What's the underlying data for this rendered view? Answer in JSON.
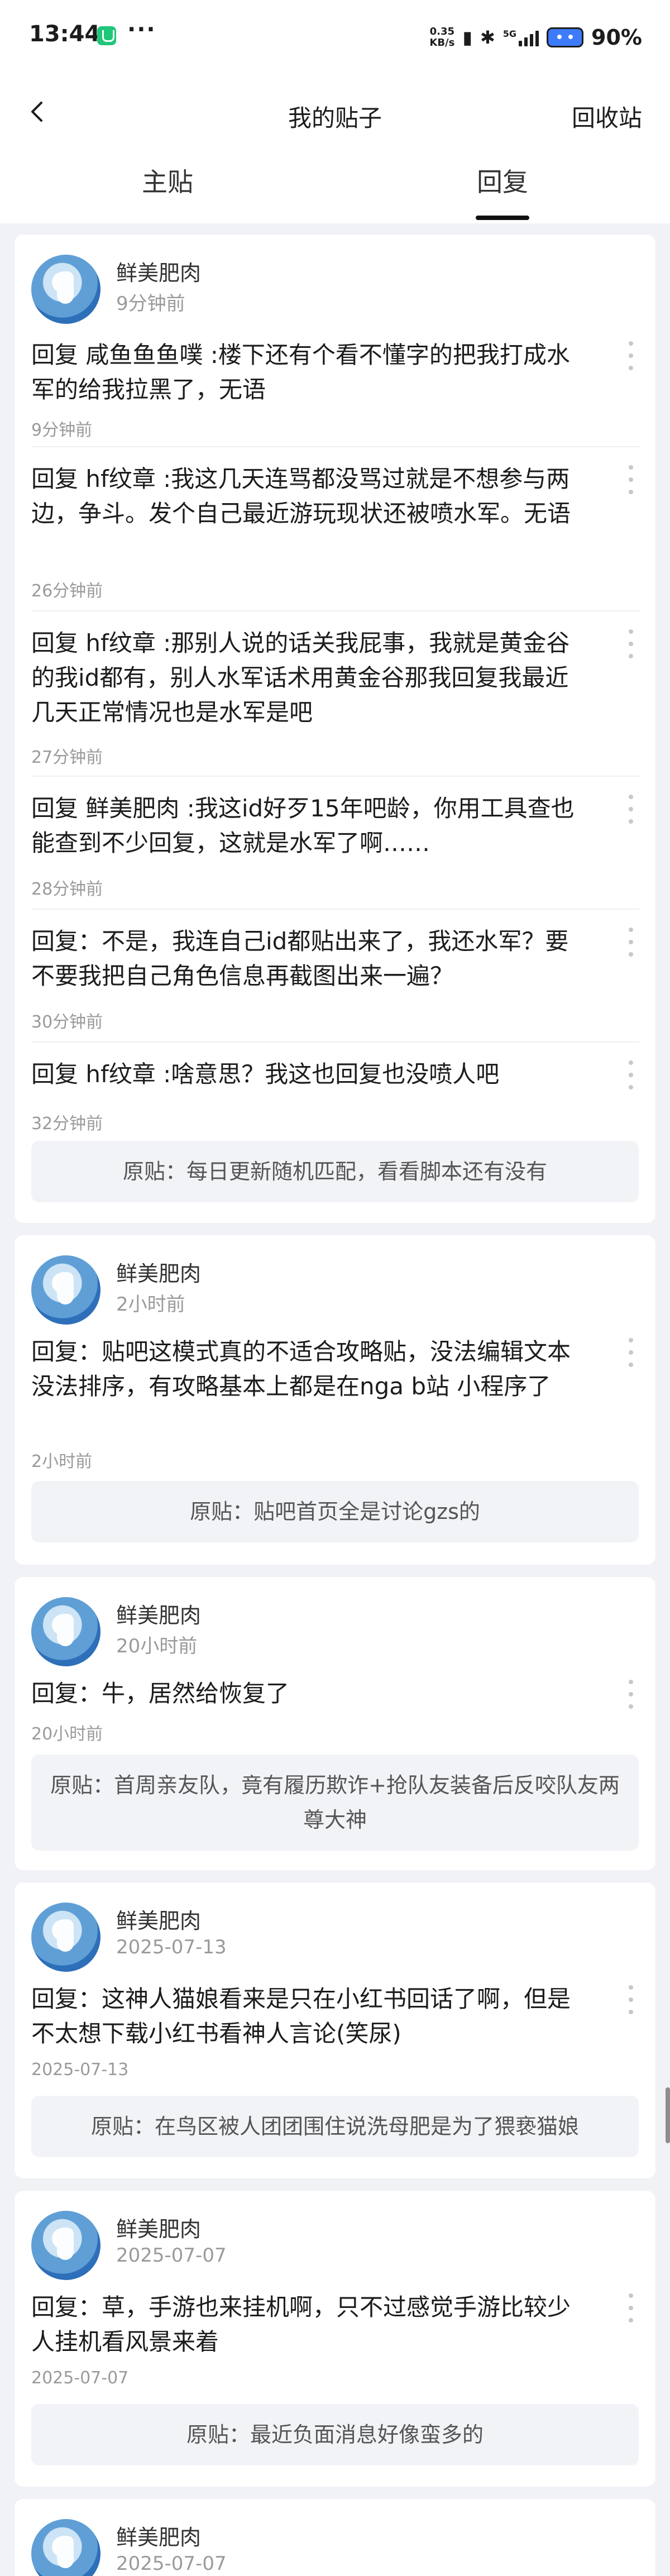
{
  "status_bar": {
    "time": "13:44",
    "more": "···",
    "speed_value": "0.35",
    "speed_unit": "KB/s",
    "network": "5G",
    "battery": "90",
    "battery_unit": "%"
  },
  "nav": {
    "title": "我的贴子",
    "action_label": "回收站"
  },
  "tabs": [
    {
      "label": "主贴",
      "active": false
    },
    {
      "label": "回复",
      "active": true
    }
  ],
  "cards": [
    {
      "user": "鲜美肥肉",
      "time": "9分钟前",
      "replies": [
        {
          "text": "回复 咸鱼鱼鱼噗 :楼下还有个看不懂字的把我打成水军的给我拉黑了，无语",
          "time": "9分钟前"
        },
        {
          "text": "回复 hf纹章 :我这几天连骂都没骂过就是不想参与两边，争斗。发个自己最近游玩现状还被喷水军。无语",
          "time": "26分钟前"
        },
        {
          "text": "回复 hf纹章 :那别人说的话关我屁事，我就是黄金谷的我id都有，别人水军话术用黄金谷那我回复我最近几天正常情况也是水军是吧",
          "time": "27分钟前"
        },
        {
          "text": "回复 鲜美肥肉 :我这id好歹15年吧龄，你用工具查也能查到不少回复，这就是水军了啊……",
          "time": "28分钟前"
        },
        {
          "text": "回复：不是，我连自己id都贴出来了，我还水军？要不要我把自己角色信息再截图出来一遍？",
          "time": "30分钟前"
        },
        {
          "text": "回复 hf纹章 :啥意思？我这也回复也没喷人吧",
          "time": "32分钟前"
        }
      ],
      "original": "原贴：每日更新随机匹配，看看脚本还有没有"
    },
    {
      "user": "鲜美肥肉",
      "time": "2小时前",
      "replies": [
        {
          "text": "回复：贴吧这模式真的不适合攻略贴，没法编辑文本没法排序，有攻略基本上都是在nga b站 小程序了",
          "time": "2小时前"
        }
      ],
      "original": "原贴：贴吧首页全是讨论gzs的"
    },
    {
      "user": "鲜美肥肉",
      "time": "20小时前",
      "replies": [
        {
          "text": "回复：牛，居然给恢复了",
          "time": "20小时前"
        }
      ],
      "original": "原贴：首周亲友队，竟有履历欺诈+抢队友装备后反咬队友两尊大神"
    },
    {
      "user": "鲜美肥肉",
      "time": "2025-07-13",
      "replies": [
        {
          "text": "回复：这神人猫娘看来是只在小红书回话了啊，但是不太想下载小红书看神人言论(笑尿)",
          "time": "2025-07-13"
        }
      ],
      "original": "原贴：在鸟区被人团团围住说洗母肥是为了猥亵猫娘"
    },
    {
      "user": "鲜美肥肉",
      "time": "2025-07-07",
      "replies": [
        {
          "text": "回复：草，手游也来挂机啊，只不过感觉手游比较少人挂机看风景来着",
          "time": "2025-07-07"
        }
      ],
      "original": "原贴：最近负面消息好像蛮多的"
    },
    {
      "user": "鲜美肥肉",
      "time": "2025-07-07",
      "replies": [],
      "original": ""
    }
  ]
}
